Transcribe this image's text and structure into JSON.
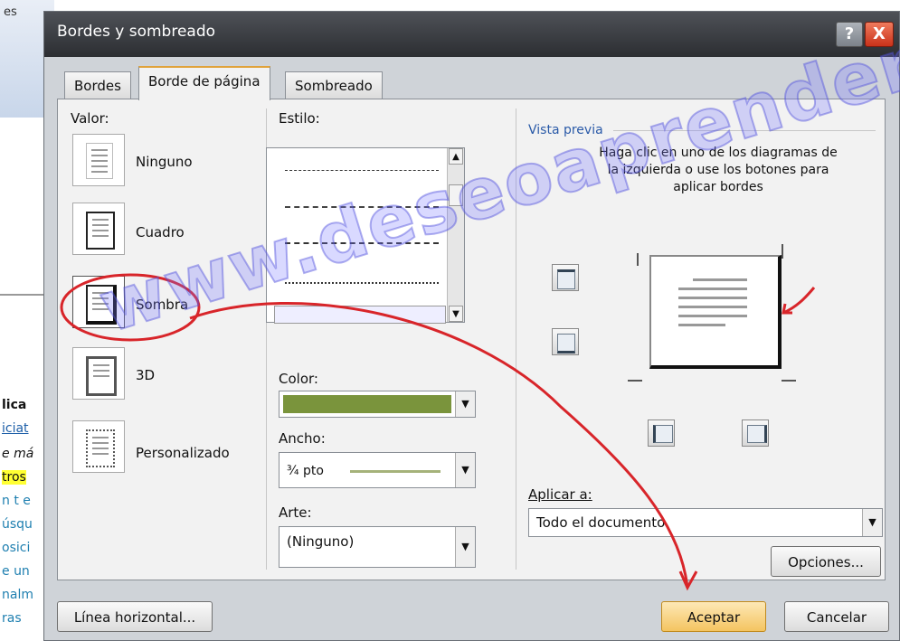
{
  "background": {
    "tab_text": "es",
    "page_lines": [
      "lica",
      "iciat",
      "e má",
      "tros",
      "n t e",
      "úsqu",
      "osici",
      "e un",
      "nalm",
      "ras"
    ]
  },
  "dialog": {
    "title": "Bordes y sombreado",
    "help_label": "?",
    "close_label": "X",
    "tabs": [
      "Bordes",
      "Borde de página",
      "Sombreado"
    ],
    "valor": {
      "label": "Valor:",
      "options": [
        "Ninguno",
        "Cuadro",
        "Sombra",
        "3D",
        "Personalizado"
      ],
      "selected": "Sombra"
    },
    "estilo": {
      "label": "Estilo:"
    },
    "color": {
      "label": "Color:",
      "value": "#7a943c"
    },
    "ancho": {
      "label": "Ancho:",
      "value": "¾ pto"
    },
    "arte": {
      "label": "Arte:",
      "value": "(Ninguno)"
    },
    "preview": {
      "label": "Vista previa",
      "instructions": "Haga clic en uno de los diagramas de la izquierda o use los botones para aplicar bordes"
    },
    "aplicar": {
      "label": "Aplicar a:",
      "value": "Todo el documento"
    },
    "opciones_label": "Opciones...",
    "linea_label": "Línea horizontal...",
    "ok_label": "Aceptar",
    "cancel_label": "Cancelar"
  },
  "watermark": "www.deseoaprender.com"
}
